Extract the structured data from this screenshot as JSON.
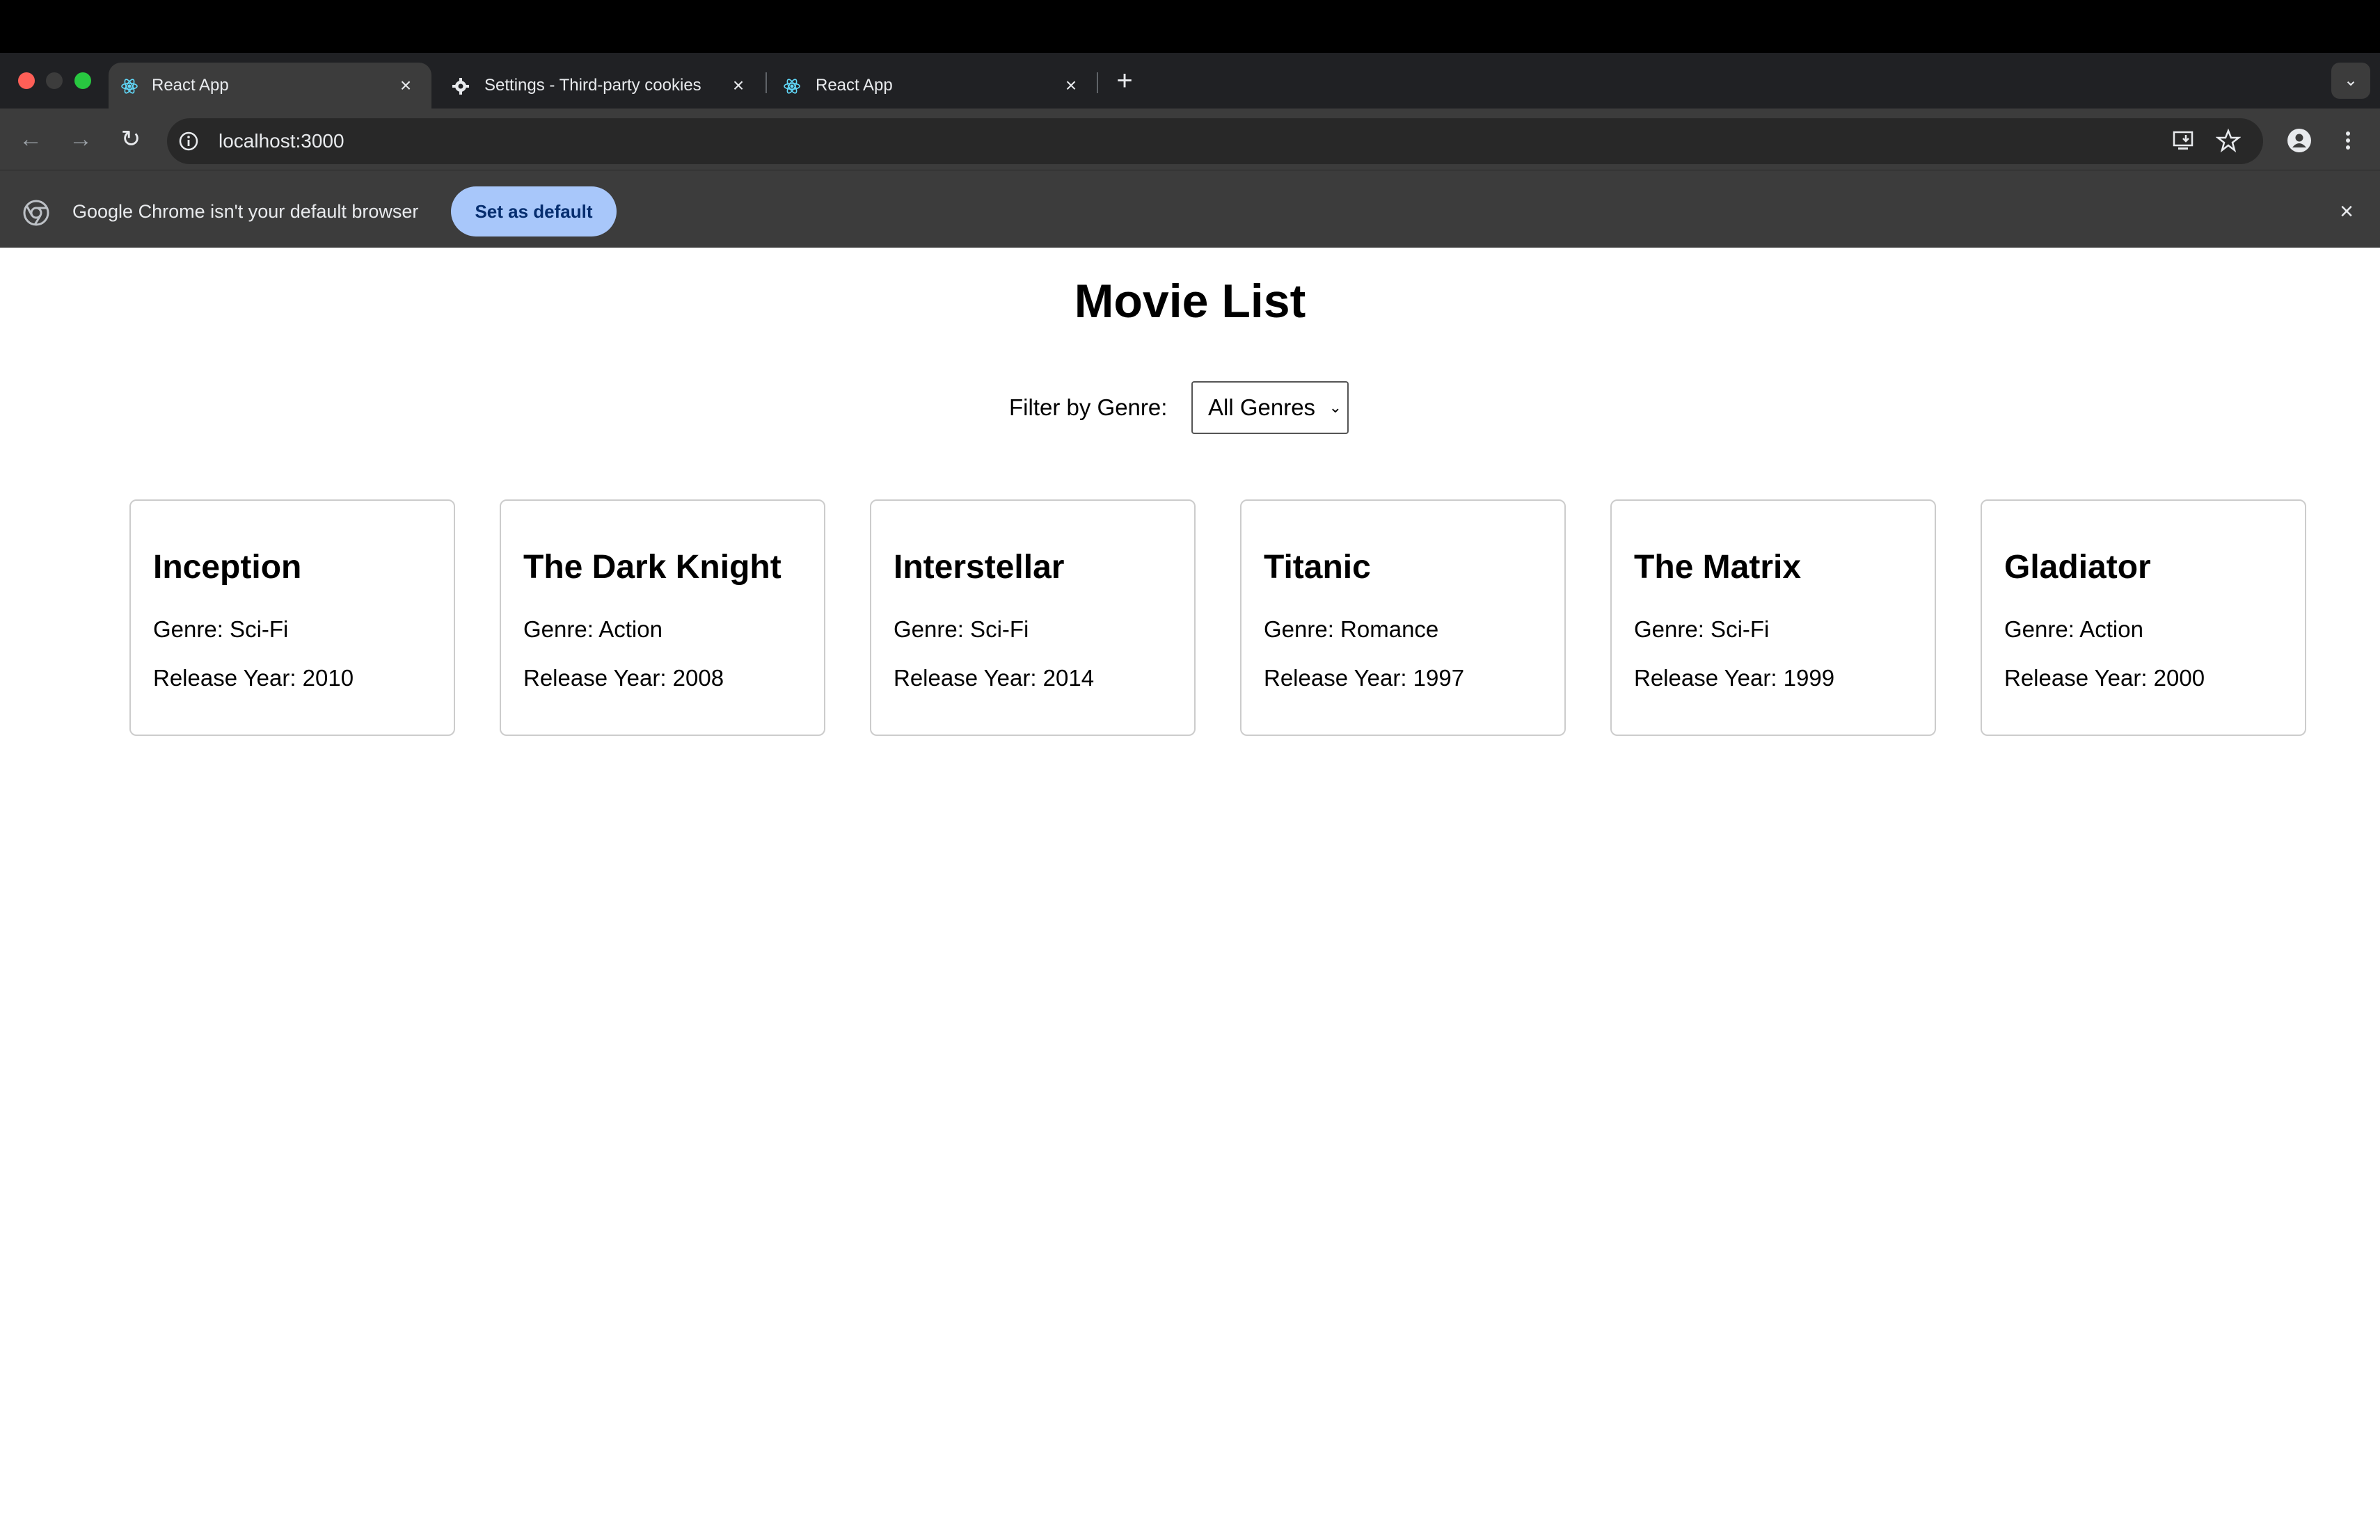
{
  "browser": {
    "tabs": [
      {
        "title": "React App",
        "active": true,
        "icon": "react-icon"
      },
      {
        "title": "Settings - Third-party cookies",
        "active": false,
        "icon": "gear-icon"
      },
      {
        "title": "React App",
        "active": false,
        "icon": "react-icon"
      }
    ],
    "address": "localhost:3000",
    "infobar": {
      "message": "Google Chrome isn't your default browser",
      "button": "Set as default"
    }
  },
  "page": {
    "title": "Movie List",
    "filter": {
      "label": "Filter by Genre:",
      "selected": "All Genres"
    },
    "movies": [
      {
        "title": "Inception",
        "genre": "Genre: Sci-Fi",
        "year": "Release Year: 2010"
      },
      {
        "title": "The Dark Knight",
        "genre": "Genre: Action",
        "year": "Release Year: 2008"
      },
      {
        "title": "Interstellar",
        "genre": "Genre: Sci-Fi",
        "year": "Release Year: 2014"
      },
      {
        "title": "Titanic",
        "genre": "Genre: Romance",
        "year": "Release Year: 1997"
      },
      {
        "title": "The Matrix",
        "genre": "Genre: Sci-Fi",
        "year": "Release Year: 1999"
      },
      {
        "title": "Gladiator",
        "genre": "Genre: Action",
        "year": "Release Year: 2000"
      }
    ]
  }
}
